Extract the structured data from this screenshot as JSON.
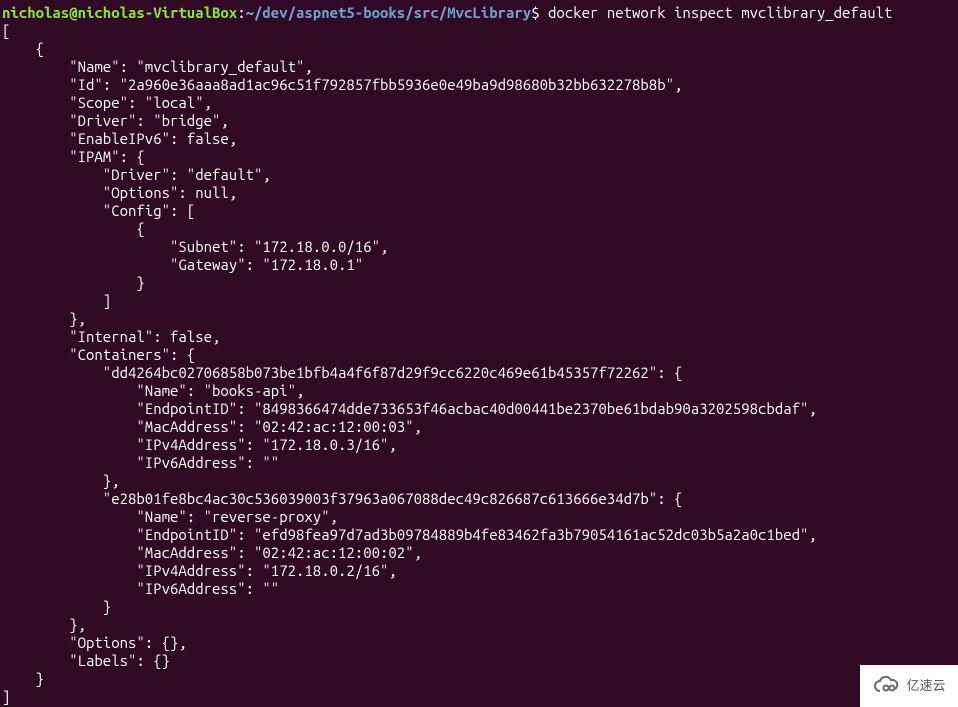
{
  "prompt": {
    "user": "nicholas@nicholas-VirtualBox",
    "sep1": ":",
    "path": "~/dev/aspnet5-books/src/MvcLibrary",
    "sep2": "$ ",
    "command": "docker network inspect mvclibrary_default"
  },
  "output": "[\n    {\n        \"Name\": \"mvclibrary_default\",\n        \"Id\": \"2a960e36aaa8ad1ac96c51f792857fbb5936e0e49ba9d98680b32bb632278b8b\",\n        \"Scope\": \"local\",\n        \"Driver\": \"bridge\",\n        \"EnableIPv6\": false,\n        \"IPAM\": {\n            \"Driver\": \"default\",\n            \"Options\": null,\n            \"Config\": [\n                {\n                    \"Subnet\": \"172.18.0.0/16\",\n                    \"Gateway\": \"172.18.0.1\"\n                }\n            ]\n        },\n        \"Internal\": false,\n        \"Containers\": {\n            \"dd4264bc02706858b073be1bfb4a4f6f87d29f9cc6220c469e61b45357f72262\": {\n                \"Name\": \"books-api\",\n                \"EndpointID\": \"8498366474dde733653f46acbac40d00441be2370be61bdab90a3202598cbdaf\",\n                \"MacAddress\": \"02:42:ac:12:00:03\",\n                \"IPv4Address\": \"172.18.0.3/16\",\n                \"IPv6Address\": \"\"\n            },\n            \"e28b01fe8bc4ac30c536039003f37963a067088dec49c826687c613666e34d7b\": {\n                \"Name\": \"reverse-proxy\",\n                \"EndpointID\": \"efd98fea97d7ad3b09784889b4fe83462fa3b79054161ac52dc03b5a2a0c1bed\",\n                \"MacAddress\": \"02:42:ac:12:00:02\",\n                \"IPv4Address\": \"172.18.0.2/16\",\n                \"IPv6Address\": \"\"\n            }\n        },\n        \"Options\": {},\n        \"Labels\": {}\n    }\n]",
  "watermark": {
    "label": "亿速云"
  }
}
